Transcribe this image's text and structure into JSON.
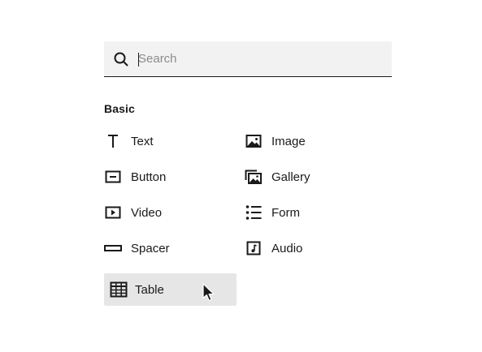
{
  "search": {
    "placeholder": "Search",
    "value": "",
    "icon": "search-icon"
  },
  "section": {
    "title": "Basic"
  },
  "items": [
    {
      "label": "Text",
      "icon": "text-icon"
    },
    {
      "label": "Image",
      "icon": "image-icon"
    },
    {
      "label": "Button",
      "icon": "button-icon"
    },
    {
      "label": "Gallery",
      "icon": "gallery-icon"
    },
    {
      "label": "Video",
      "icon": "video-icon"
    },
    {
      "label": "Form",
      "icon": "form-icon"
    },
    {
      "label": "Spacer",
      "icon": "spacer-icon"
    },
    {
      "label": "Audio",
      "icon": "audio-icon"
    },
    {
      "label": "Table",
      "icon": "table-icon",
      "state": "hovered"
    }
  ],
  "colors": {
    "ink": "#1a1a1a",
    "search_bg": "#f2f2f2",
    "placeholder": "#8c8c8c",
    "hover_bg": "#e6e6e6"
  }
}
